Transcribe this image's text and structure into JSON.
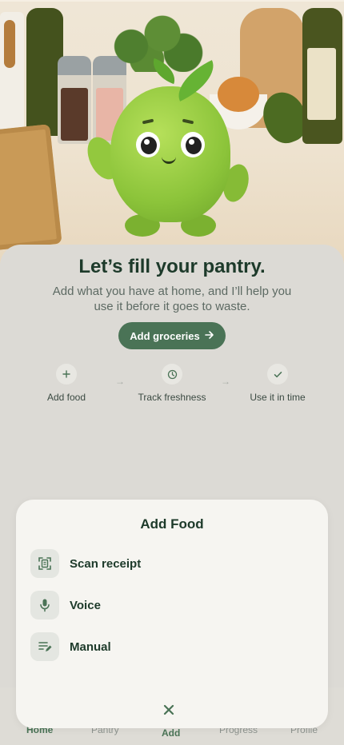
{
  "colors": {
    "accent": "#4a7356",
    "headline": "#1d3a2a",
    "background": "#dcdad5",
    "sheet": "#f6f5f1"
  },
  "hero": {
    "illustration": "green-apple-mascot-in-kitchen"
  },
  "main": {
    "headline": "Let’s fill your pantry.",
    "subtext": "Add what you have at home, and I’ll help you use it before it goes to waste.",
    "cta_label": "Add groceries",
    "steps": [
      {
        "icon": "plus-icon",
        "label": "Add food"
      },
      {
        "icon": "clock-icon",
        "label": "Track freshness"
      },
      {
        "icon": "check-icon",
        "label": "Use it in time"
      }
    ]
  },
  "sheet": {
    "title": "Add Food",
    "options": [
      {
        "icon": "scan-icon",
        "label": "Scan receipt"
      },
      {
        "icon": "mic-icon",
        "label": "Voice"
      },
      {
        "icon": "edit-list-icon",
        "label": "Manual"
      }
    ],
    "close_icon": "close-icon"
  },
  "nav": {
    "items": [
      {
        "label": "Home",
        "active": true
      },
      {
        "label": "Pantry"
      },
      {
        "label": "Add"
      },
      {
        "label": "Progress"
      },
      {
        "label": "Profile"
      }
    ]
  }
}
